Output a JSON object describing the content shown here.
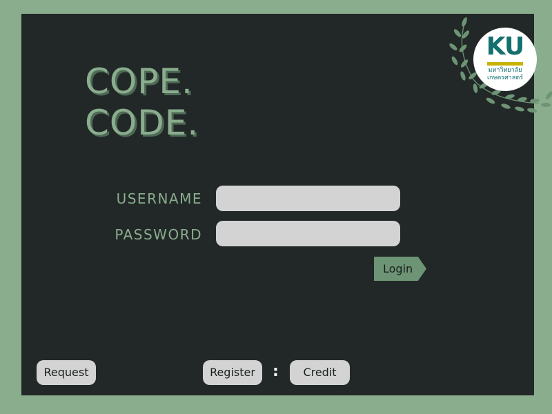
{
  "title": {
    "line1": "COPE.",
    "line2": "CODE."
  },
  "form": {
    "username_label": "USERNAME",
    "password_label": "PASSWORD",
    "username_value": "",
    "password_value": "",
    "login_label": "Login"
  },
  "footer": {
    "request_label": "Request",
    "register_label": "Register",
    "separator": ":",
    "credit_label": "Credit"
  },
  "logo": {
    "mark": "KU",
    "line1": "มหาวิทยาลัย",
    "line2": "เกษตรศาสตร์"
  },
  "colors": {
    "background": "#8aad8e",
    "panel": "#222827",
    "accent": "#8aad8e",
    "input": "#d3d3d3",
    "login_button": "#6d9474",
    "logo_teal": "#14706f",
    "logo_yellow": "#c8b400"
  }
}
